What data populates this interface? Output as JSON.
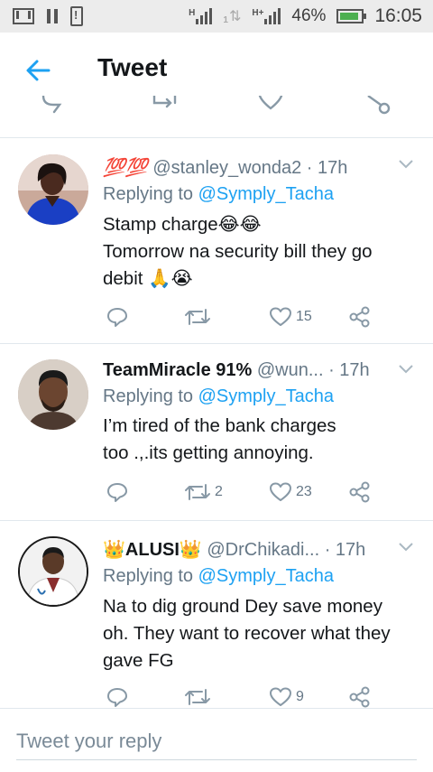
{
  "status_bar": {
    "battery": "46%",
    "time": "16:05",
    "network_1": "H",
    "network_2": "1",
    "network_3": "H+"
  },
  "header": {
    "title": "Tweet"
  },
  "tweets": [
    {
      "name": "💯💯",
      "handle": "@stanley_wonda2",
      "time": "· 17h",
      "replying_prefix": "Replying to ",
      "replying_to": "@Symply_Tacha",
      "text_line1": "Stamp charge😂😂",
      "text_line2": "Tomorrow na security bill they go",
      "text_line3": "debit 🙏😭",
      "retweets": "",
      "likes": "15"
    },
    {
      "name": "TeamMiracle 91%",
      "handle": "@wun...",
      "time": "· 17h",
      "replying_prefix": "Replying to ",
      "replying_to": "@Symply_Tacha",
      "text_line1": "I’m tired of the bank charges",
      "text_line2": "too .,.its getting annoying.",
      "retweets": "2",
      "likes": "23"
    },
    {
      "name": "👑ALUSI👑",
      "handle": "@DrChikadi...",
      "time": "· 17h",
      "replying_prefix": "Replying to ",
      "replying_to": "@Symply_Tacha",
      "text_line1": "Na to dig ground Dey save money",
      "text_line2": "oh. They want to recover what they",
      "text_line3": "gave FG",
      "retweets": "",
      "likes": "9"
    }
  ],
  "reply": {
    "placeholder": "Tweet your reply"
  },
  "colors": {
    "accent": "#1da1f2",
    "secondary_text": "#657786",
    "divider": "#e1e8ed",
    "status_bar_bg": "#ececec"
  }
}
